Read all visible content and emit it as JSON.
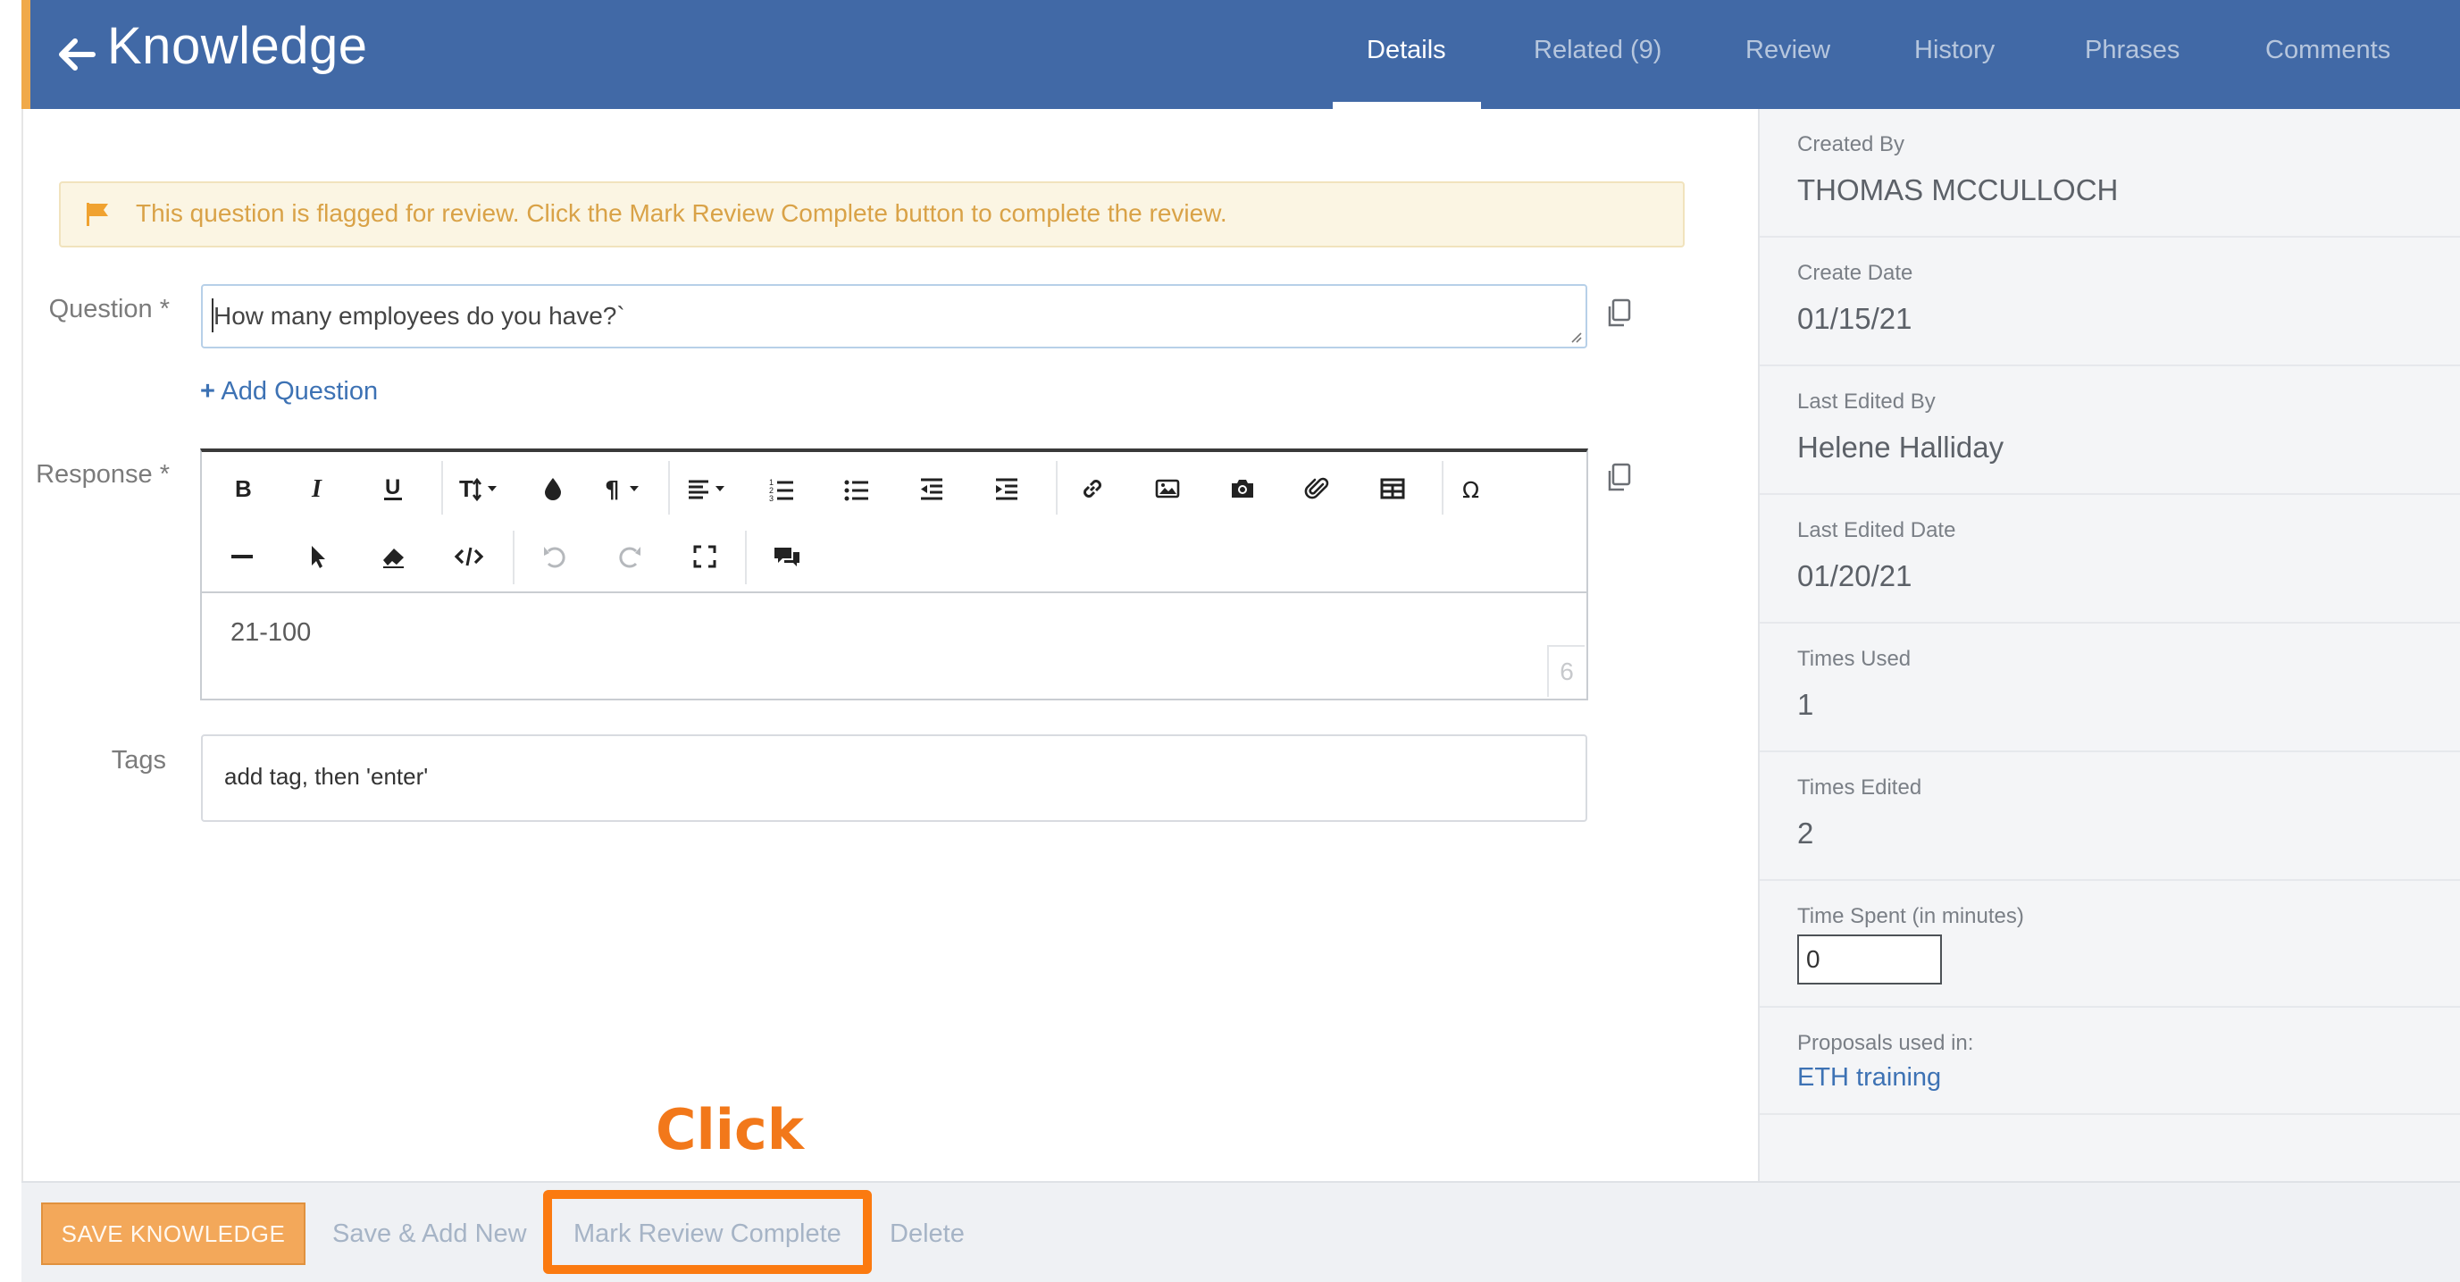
{
  "header": {
    "title": "Knowledge",
    "tabs": [
      {
        "label": "Details",
        "active": true
      },
      {
        "label": "Related (9)",
        "active": false
      },
      {
        "label": "Review",
        "active": false
      },
      {
        "label": "History",
        "active": false
      },
      {
        "label": "Phrases",
        "active": false
      },
      {
        "label": "Comments",
        "active": false
      }
    ]
  },
  "alert": {
    "icon": "flag-icon",
    "text": "This question is flagged for review. Click the Mark Review Complete button to complete the review."
  },
  "form": {
    "question_label": "Question *",
    "question_value": "How many employees do you have?`",
    "add_question": "Add Question",
    "response_label": "Response *",
    "response_value": "21-100",
    "char_count": "6",
    "tags_label": "Tags",
    "tags_placeholder": "add tag, then 'enter'"
  },
  "sidebar": {
    "created_by_label": "Created By",
    "created_by": "THOMAS MCCULLOCH",
    "create_date_label": "Create Date",
    "create_date": "01/15/21",
    "last_edited_by_label": "Last Edited By",
    "last_edited_by": "Helene Halliday",
    "last_edited_date_label": "Last Edited Date",
    "last_edited_date": "01/20/21",
    "times_used_label": "Times Used",
    "times_used": "1",
    "times_edited_label": "Times Edited",
    "times_edited": "2",
    "time_spent_label": "Time Spent (in minutes)",
    "time_spent": "0",
    "proposals_label": "Proposals used in:",
    "proposals": "ETH training"
  },
  "footer": {
    "save_label": "SAVE KNOWLEDGE",
    "save_add_new_label": "Save & Add New",
    "mark_review_label": "Mark Review Complete",
    "delete_label": "Delete",
    "annotation_label": "Click"
  },
  "colors": {
    "header": "#4169a6",
    "accent": "#f0a94a",
    "link": "#3d72b4",
    "highlight": "#fb7a10",
    "alert_text": "#d9a247"
  }
}
